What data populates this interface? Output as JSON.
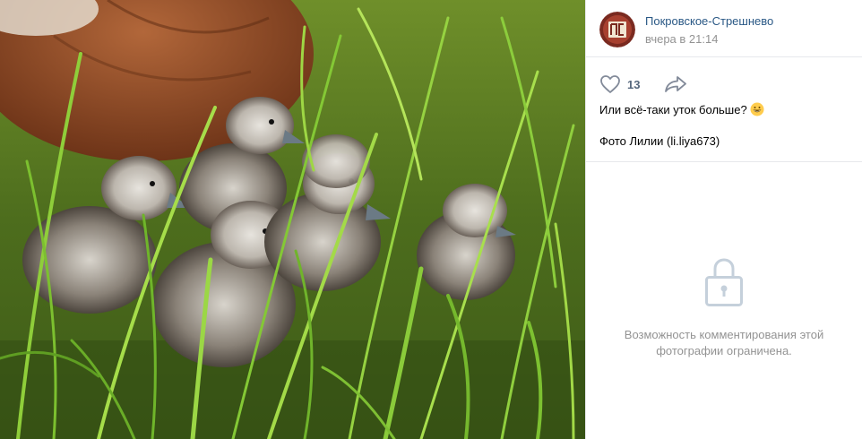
{
  "photo": {
    "icon": "photo-of-ducklings-in-grass"
  },
  "post": {
    "author": "Покровское-Стрешнево",
    "date": "вчера в 21:14",
    "avatar_icon": "community-logo-icon",
    "like_icon": "heart-icon",
    "like_count": "13",
    "share_icon": "share-arrow-icon",
    "caption_line1": "Или всё-таки уток больше?",
    "caption_emoji": "grinning-face-icon",
    "caption_line2": "Фото Лилии (li.liya673)"
  },
  "comments": {
    "lock_icon": "lock-icon",
    "restricted_text": "Возможность комментирования этой фотографии ограничена."
  },
  "colors": {
    "link": "#2a5885",
    "muted": "#939393",
    "border": "#e7e8ec",
    "icon": "#828a99"
  }
}
